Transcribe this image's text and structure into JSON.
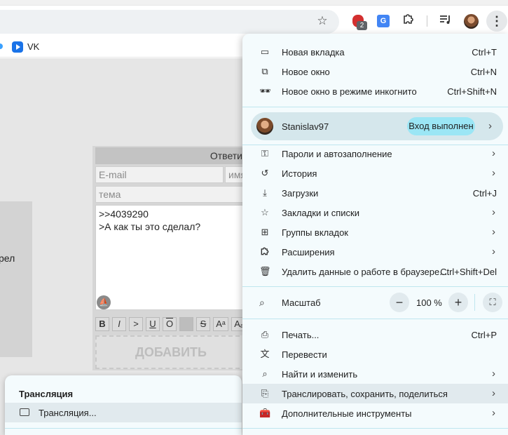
{
  "bookmarks": [
    {
      "label": "VK"
    }
  ],
  "toolbar": {
    "extension_badge": "2",
    "translate_icon": "G"
  },
  "page": {
    "left_text": "рел",
    "form": {
      "header": "Ответи",
      "email_placeholder": "E-mail",
      "name_placeholder": "имя",
      "subject_placeholder": "тема",
      "message_lines": [
        ">>4039290",
        ">А как ты это сделал?"
      ],
      "format_buttons": [
        "B",
        "I",
        ">",
        "U",
        "O",
        "",
        "S",
        "Aᵃ",
        "Aₐ"
      ],
      "submit_label": "ДОБАВИТЬ"
    }
  },
  "cast_panel": {
    "title": "Трансляция",
    "item": "Трансляция..."
  },
  "menu": {
    "items_top": [
      {
        "icon": "new-tab-icon",
        "label": "Новая вкладка",
        "shortcut": "Ctrl+T"
      },
      {
        "icon": "new-window-icon",
        "label": "Новое окно",
        "shortcut": "Ctrl+N"
      },
      {
        "icon": "incognito-icon",
        "label": "Новое окно в режиме инкогнито",
        "shortcut": "Ctrl+Shift+N"
      }
    ],
    "profile": {
      "name": "Stanislav97",
      "status": "Вход выполнен"
    },
    "items_mid": [
      {
        "icon": "key-icon",
        "label": "Пароли и автозаполнение",
        "shortcut": "",
        "submenu": true
      },
      {
        "icon": "history-icon",
        "label": "История",
        "shortcut": "",
        "submenu": true
      },
      {
        "icon": "download-icon",
        "label": "Загрузки",
        "shortcut": "Ctrl+J",
        "submenu": false
      },
      {
        "icon": "bookmark-star-icon",
        "label": "Закладки и списки",
        "shortcut": "",
        "submenu": true
      },
      {
        "icon": "tab-groups-icon",
        "label": "Группы вкладок",
        "shortcut": "",
        "submenu": true
      },
      {
        "icon": "puzzle-icon",
        "label": "Расширения",
        "shortcut": "",
        "submenu": true
      },
      {
        "icon": "trash-icon",
        "label": "Удалить данные о работе в браузере...",
        "shortcut": "Ctrl+Shift+Del",
        "submenu": false
      }
    ],
    "zoom": {
      "label": "Масштаб",
      "value": "100 %",
      "minus": "−",
      "plus": "+"
    },
    "items_bottom": [
      {
        "icon": "print-icon",
        "label": "Печать...",
        "shortcut": "Ctrl+P",
        "submenu": false
      },
      {
        "icon": "translate-icon",
        "label": "Перевести",
        "shortcut": "",
        "submenu": false
      },
      {
        "icon": "find-icon",
        "label": "Найти и изменить",
        "shortcut": "",
        "submenu": true
      },
      {
        "icon": "cast-save-share-icon",
        "label": "Транслировать, сохранить, поделиться",
        "shortcut": "",
        "submenu": true
      },
      {
        "icon": "toolbox-icon",
        "label": "Дополнительные инструменты",
        "shortcut": "",
        "submenu": true
      }
    ]
  }
}
